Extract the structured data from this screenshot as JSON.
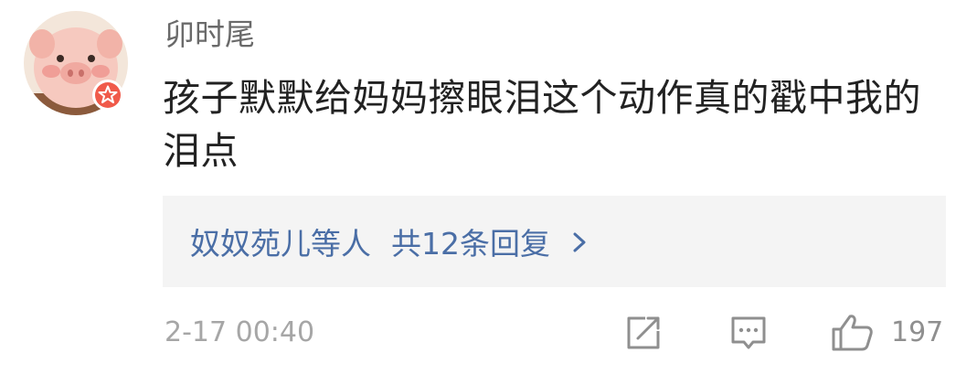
{
  "comment": {
    "username": "卯时尾",
    "text": "孩子默默给妈妈擦眼泪这个动作真的戳中我的泪点",
    "replies": {
      "names": "奴奴苑儿等人",
      "count_label": "共12条回复"
    },
    "timestamp": "2-17 00:40",
    "like_count": "197"
  }
}
